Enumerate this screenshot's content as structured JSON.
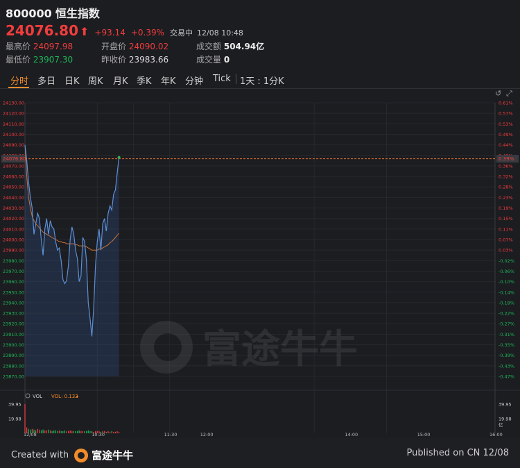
{
  "header": {
    "code": "800000",
    "name": "恒生指数",
    "price": "24076.80",
    "change": "+93.14",
    "change_pct": "+0.39%",
    "status": "交易中",
    "datetime": "12/08 10:48"
  },
  "stats": {
    "high_label": "最高价",
    "high": "24097.98",
    "open_label": "开盘价",
    "open": "24090.02",
    "turnover_label": "成交额",
    "turnover": "504.94亿",
    "low_label": "最低价",
    "low": "23907.30",
    "prev_close_label": "昨收价",
    "prev_close": "23983.66",
    "volume_label": "成交量",
    "volume": "0"
  },
  "tabs": [
    "分时",
    "多日",
    "日K",
    "周K",
    "月K",
    "季K",
    "年K",
    "分钟",
    "Tick"
  ],
  "active_tab": "分时",
  "period_selector": "1天 : 1分K",
  "controls": {
    "undo_icon": "↺",
    "expand_icon": "⤢"
  },
  "colors": {
    "up": "#f23d3d",
    "down": "#1fb65a",
    "accent": "#f28c2b",
    "line": "#5b8fd6",
    "avg": "#c8733a"
  },
  "chart_data": {
    "type": "line",
    "y_left_ticks": [
      "24130.00",
      "24120.00",
      "24110.00",
      "24100.00",
      "24090.00",
      "24080.00",
      "24070.00",
      "24060.00",
      "24050.00",
      "24040.00",
      "24030.00",
      "24020.00",
      "24010.00",
      "24000.00",
      "23990.00",
      "23980.00",
      "23970.00",
      "23960.00",
      "23950.00",
      "23940.00",
      "23930.00",
      "23920.00",
      "23910.00",
      "23900.00",
      "23890.00",
      "23880.00",
      "23870.00"
    ],
    "y_right_ticks": [
      "0.61%",
      "0.57%",
      "0.53%",
      "0.49%",
      "0.44%",
      "0.40%",
      "0.36%",
      "0.32%",
      "0.28%",
      "0.23%",
      "0.19%",
      "0.15%",
      "0.11%",
      "0.07%",
      "0.03%",
      "-0.02%",
      "-0.06%",
      "-0.10%",
      "-0.14%",
      "-0.18%",
      "-0.22%",
      "-0.27%",
      "-0.31%",
      "-0.35%",
      "-0.39%",
      "-0.43%",
      "-0.47%"
    ],
    "current_price_label": "24076.80",
    "current_pct_label": "0.39%",
    "x_ticks": [
      "12/08",
      "10:30",
      "11:30",
      "12:00",
      "14:00",
      "15:00",
      "16:00"
    ],
    "price_series": [
      24090,
      24075,
      24055,
      24040,
      24030,
      24005,
      24015,
      24025,
      24020,
      24000,
      23985,
      24010,
      24020,
      24005,
      24018,
      24012,
      24010,
      23998,
      23990,
      23992,
      23980,
      23962,
      23958,
      23961,
      23975,
      24000,
      24012,
      24005,
      23990,
      23982,
      23960,
      23965,
      24002,
      23998,
      23980,
      23940,
      23925,
      23908,
      23935,
      23975,
      23998,
      24010,
      23990,
      24015,
      24020,
      24008,
      24025,
      24032,
      24028,
      24043,
      24047,
      24063,
      24078
    ],
    "avg_series": [
      24090,
      24060,
      24040,
      24030,
      24022,
      24018,
      24015,
      24013,
      24011,
      24009,
      24007,
      24006,
      24005,
      24004,
      24003,
      24002,
      24001,
      24000,
      23999,
      23998,
      23998,
      23997,
      23997,
      23996,
      23996,
      23996,
      23996,
      23996,
      23995,
      23995,
      23994,
      23994,
      23994,
      23994,
      23993,
      23992,
      23991,
      23990,
      23990,
      23990,
      23990,
      23991,
      23991,
      23992,
      23993,
      23994,
      23995,
      23997,
      23998,
      24000,
      24002,
      24004,
      24006
    ],
    "ylim": [
      23870,
      24130
    ],
    "volume_label": "VOL",
    "volume_value_label": "VOL: 0.132",
    "volume_ticks_left": [
      "39.95",
      "19.98"
    ],
    "volume_ticks_right": [
      "39.95",
      "19.98",
      "亿"
    ],
    "volume_series": [
      39.95,
      8,
      6,
      5,
      6,
      5,
      4,
      6,
      5,
      4,
      5,
      4,
      4,
      5,
      4,
      3,
      4,
      4,
      3,
      4,
      3,
      3,
      4,
      3,
      3,
      4,
      3,
      3,
      3,
      3,
      4,
      3,
      3,
      3,
      3,
      4,
      3,
      3,
      2,
      3,
      3,
      3,
      2,
      3,
      3,
      2,
      3,
      2,
      3,
      2,
      2,
      3,
      2
    ],
    "volume_colors": [
      "up",
      "up",
      "down",
      "down",
      "up",
      "down",
      "down",
      "up",
      "up",
      "down",
      "down",
      "up",
      "up",
      "down",
      "up",
      "down",
      "down",
      "down",
      "down",
      "up",
      "down",
      "down",
      "down",
      "up",
      "up",
      "up",
      "up",
      "down",
      "down",
      "down",
      "down",
      "up",
      "up",
      "down",
      "down",
      "down",
      "down",
      "down",
      "up",
      "up",
      "up",
      "up",
      "down",
      "up",
      "up",
      "down",
      "up",
      "up",
      "down",
      "up",
      "up",
      "up",
      "up"
    ]
  },
  "watermark": "富途牛牛",
  "footer": {
    "created": "Created with",
    "brand": "富途牛牛",
    "published": "Published on CN 12/08"
  }
}
